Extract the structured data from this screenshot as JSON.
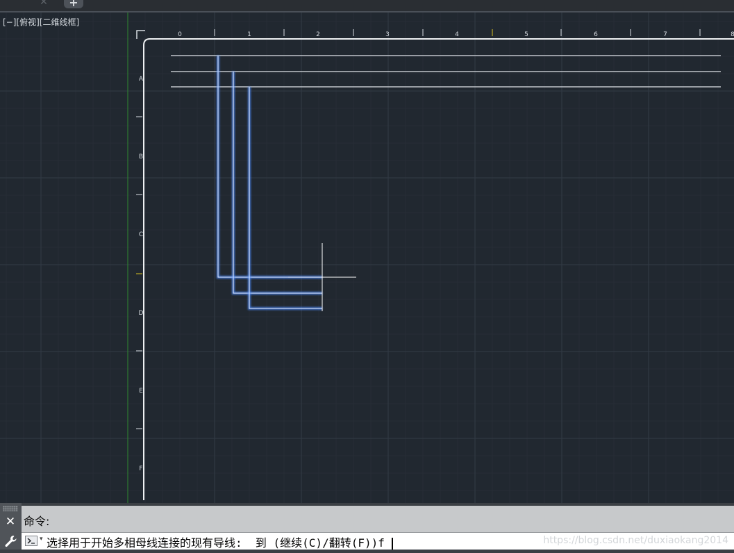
{
  "tabs": {
    "close_glyph": "✕",
    "new_glyph": "+"
  },
  "viewport": {
    "view_label": "[−][俯视][二维线框]",
    "background": "#212830",
    "ruler_top_labels": [
      "0",
      "1",
      "2",
      "3",
      "4",
      "5",
      "6",
      "7",
      "8"
    ],
    "ruler_left_labels": [
      "A",
      "B",
      "C",
      "D",
      "E",
      "F"
    ],
    "polyline_color": "#4d8cff",
    "line_color": "#dfe3e8",
    "cursor_color": "#ffffff"
  },
  "command": {
    "history_line": "命令:",
    "input_line": "选择用于开始多相母线连接的现有导线:  到 (继续(C)/翻转(F))f",
    "watermark": "https://blog.csdn.net/duxiaokang2014",
    "close_icon": "✕",
    "settings_icon": "wrench-icon",
    "prompt_icon": "terminal-icon"
  }
}
